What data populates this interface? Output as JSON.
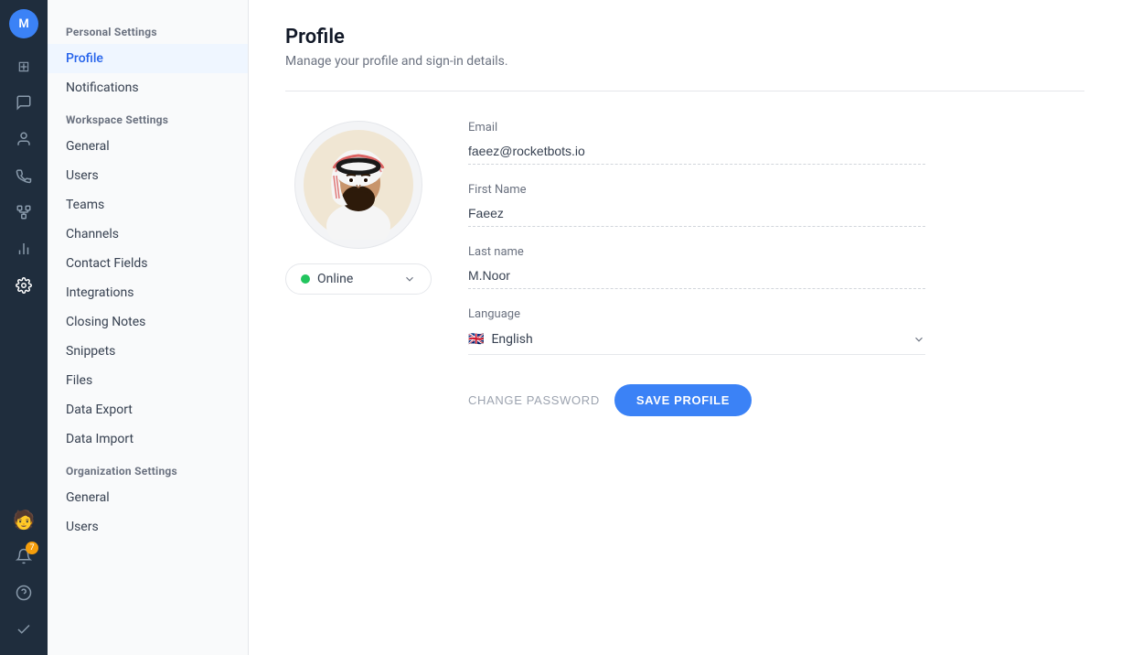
{
  "iconSidebar": {
    "avatarInitial": "M",
    "icons": [
      {
        "name": "dashboard-icon",
        "symbol": "⊞",
        "active": false
      },
      {
        "name": "chat-icon",
        "symbol": "💬",
        "active": false
      },
      {
        "name": "contacts-icon",
        "symbol": "👤",
        "active": false
      },
      {
        "name": "broadcast-icon",
        "symbol": "📡",
        "active": false
      },
      {
        "name": "tree-icon",
        "symbol": "🌿",
        "active": false
      },
      {
        "name": "reports-icon",
        "symbol": "📊",
        "active": false
      },
      {
        "name": "settings-icon",
        "symbol": "⚙",
        "active": true
      }
    ],
    "bottomIcons": [
      {
        "name": "avatar-user-icon",
        "symbol": "🧑",
        "badge": null
      },
      {
        "name": "notifications-icon",
        "symbol": "🔔",
        "badge": "7"
      },
      {
        "name": "help-icon",
        "symbol": "?",
        "badge": null
      },
      {
        "name": "check-icon",
        "symbol": "✓",
        "badge": null
      }
    ]
  },
  "leftSidebar": {
    "sections": [
      {
        "title": "Personal Settings",
        "items": [
          {
            "label": "Profile",
            "active": true
          },
          {
            "label": "Notifications",
            "active": false
          }
        ]
      },
      {
        "title": "Workspace Settings",
        "items": [
          {
            "label": "General",
            "active": false
          },
          {
            "label": "Users",
            "active": false
          },
          {
            "label": "Teams",
            "active": false
          },
          {
            "label": "Channels",
            "active": false
          },
          {
            "label": "Contact Fields",
            "active": false
          },
          {
            "label": "Integrations",
            "active": false
          },
          {
            "label": "Closing Notes",
            "active": false
          },
          {
            "label": "Snippets",
            "active": false
          },
          {
            "label": "Files",
            "active": false
          },
          {
            "label": "Data Export",
            "active": false
          },
          {
            "label": "Data Import",
            "active": false
          }
        ]
      },
      {
        "title": "Organization Settings",
        "items": [
          {
            "label": "General",
            "active": false
          },
          {
            "label": "Users",
            "active": false
          }
        ]
      }
    ]
  },
  "main": {
    "title": "Profile",
    "subtitle": "Manage your profile and sign-in details.",
    "status": {
      "label": "Online",
      "color": "#22c55e"
    },
    "form": {
      "emailLabel": "Email",
      "emailValue": "faeez@rocketbots.io",
      "firstNameLabel": "First Name",
      "firstNameValue": "Faeez",
      "lastNameLabel": "Last name",
      "lastNameValue": "M.Noor",
      "languageLabel": "Language",
      "languageFlag": "🇬🇧",
      "languageValue": "English"
    },
    "actions": {
      "changePasswordLabel": "CHANGE PASSWORD",
      "saveProfileLabel": "SAVE PROFILE"
    }
  }
}
